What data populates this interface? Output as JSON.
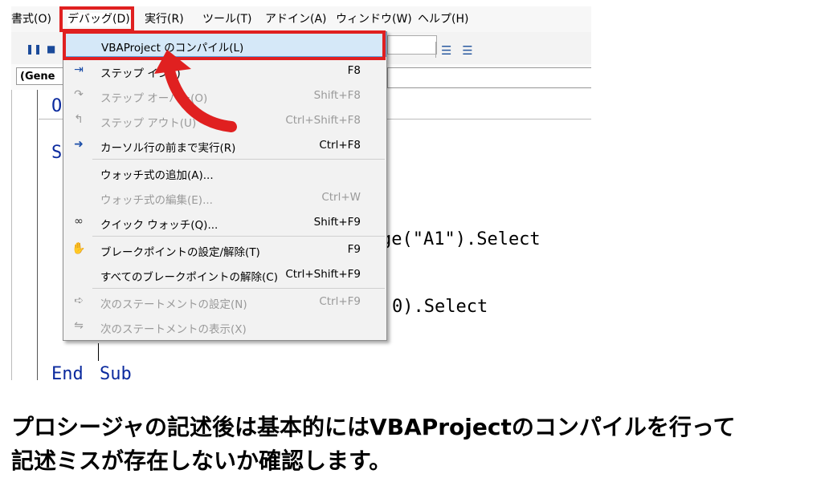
{
  "menubar": {
    "items": [
      {
        "label": "書式(O)"
      },
      {
        "label": "デバッグ(D)"
      },
      {
        "label": "実行(R)"
      },
      {
        "label": "ツール(T)"
      },
      {
        "label": "アドイン(A)"
      },
      {
        "label": "ウィンドウ(W)"
      },
      {
        "label": "ヘルプ(H)"
      }
    ]
  },
  "object_combo": {
    "value": "(Gene"
  },
  "code": {
    "line1": "O",
    "line2": "S",
    "line3": "ge(\"A1\").Select",
    "line4": "0).Select",
    "end_keyword": "End",
    "end_sub": "Sub"
  },
  "debug_menu": {
    "items": [
      {
        "label": "VBAProject のコンパイル(L)",
        "shortcut": "",
        "icon": "",
        "disabled": false
      },
      {
        "label": "ステップ イン(I)",
        "shortcut": "F8",
        "icon": "step-into-icon",
        "disabled": false
      },
      {
        "label": "ステップ オーバー(O)",
        "shortcut": "Shift+F8",
        "icon": "step-over-icon",
        "disabled": true
      },
      {
        "label": "ステップ アウト(U)",
        "shortcut": "Ctrl+Shift+F8",
        "icon": "step-out-icon",
        "disabled": true
      },
      {
        "label": "カーソル行の前まで実行(R)",
        "shortcut": "Ctrl+F8",
        "icon": "run-to-cursor-icon",
        "disabled": false
      },
      {
        "label": "ウォッチ式の追加(A)...",
        "shortcut": "",
        "icon": "",
        "disabled": false
      },
      {
        "label": "ウォッチ式の編集(E)...",
        "shortcut": "Ctrl+W",
        "icon": "",
        "disabled": true
      },
      {
        "label": "クイック ウォッチ(Q)...",
        "shortcut": "Shift+F9",
        "icon": "glasses-icon",
        "disabled": false
      },
      {
        "label": "ブレークポイントの設定/解除(T)",
        "shortcut": "F9",
        "icon": "hand-icon",
        "disabled": false
      },
      {
        "label": "すべてのブレークポイントの解除(C)",
        "shortcut": "Ctrl+Shift+F9",
        "icon": "",
        "disabled": false
      },
      {
        "label": "次のステートメントの設定(N)",
        "shortcut": "Ctrl+F9",
        "icon": "arrow-right-icon",
        "disabled": true
      },
      {
        "label": "次のステートメントの表示(X)",
        "shortcut": "",
        "icon": "show-next-icon",
        "disabled": true
      }
    ]
  },
  "caption": {
    "line1": "プロシージャの記述後は基本的にはVBAProjectのコンパイルを行って",
    "line2": "記述ミスが存在しないか確認します。"
  },
  "colors": {
    "highlight_red": "#e02020",
    "menu_hover": "#d5e8f8",
    "keyword_blue": "#0b2a9e"
  }
}
